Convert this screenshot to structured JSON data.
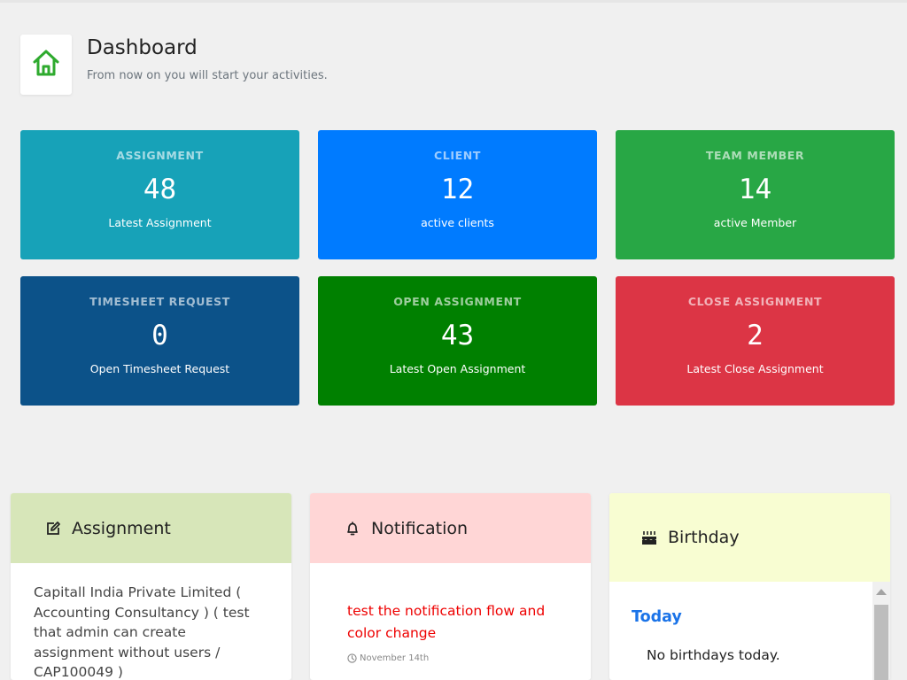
{
  "header": {
    "icon": "home-icon",
    "title": "Dashboard",
    "subtitle": "From now on you will start your activities."
  },
  "stats": [
    {
      "title": "ASSIGNMENT",
      "value": "48",
      "desc": "Latest Assignment",
      "color": "#17a2b8"
    },
    {
      "title": "CLIENT",
      "value": "12",
      "desc": "active clients",
      "color": "#007bff"
    },
    {
      "title": "TEAM MEMBER",
      "value": "14",
      "desc": "active Member",
      "color": "#28a745"
    },
    {
      "title": "TIMESHEET REQUEST",
      "value": "0",
      "desc": "Open Timesheet Request",
      "color": "#0c5289"
    },
    {
      "title": "OPEN ASSIGNMENT",
      "value": "43",
      "desc": "Latest Open Assignment",
      "color": "#008000"
    },
    {
      "title": "CLOSE ASSIGNMENT",
      "value": "2",
      "desc": "Latest Close Assignment",
      "color": "#dc3545"
    }
  ],
  "panels": {
    "assignment": {
      "title": "Assignment",
      "icon": "edit-icon",
      "header_color": "#d7e6b9",
      "text": "Capitall India Private Limited ( Accounting Consultancy ) ( test that admin can create assignment without users / CAP100049 )"
    },
    "notification": {
      "title": "Notification",
      "icon": "bell-icon",
      "header_color": "#ffd6d6",
      "text": "test the notification flow and color change",
      "date": "November 14th",
      "date_icon": "clock-icon"
    },
    "birthday": {
      "title": "Birthday",
      "icon": "birthday-cake-icon",
      "header_color": "#f8fdd2",
      "today_label": "Today",
      "empty_text": "No birthdays today."
    }
  }
}
